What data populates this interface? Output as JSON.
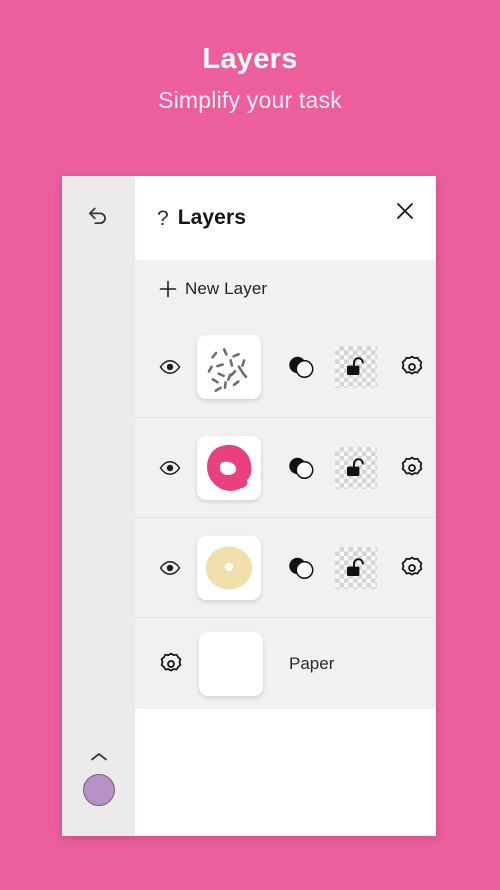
{
  "promo": {
    "title": "Layers",
    "subtitle": "Simplify your task"
  },
  "colors": {
    "background_pink": "#ec5f9c",
    "panel_white": "#ffffff",
    "row_grey": "#f1f1f1",
    "toolbar_grey": "#eceaea",
    "swatch_purple": "#b891c8",
    "frosting_pink": "#e8417e",
    "dough_cream": "#f0e0ab"
  },
  "toolbar": {
    "undo_icon": "undo-arrow-icon",
    "chevron_icon": "chevron-up-icon",
    "swatch_icon": "color-swatch",
    "swatch_color": "#b891c8"
  },
  "panel": {
    "help_icon": "?",
    "title": "Layers",
    "close_icon": "close-x-icon",
    "new_layer": {
      "plus_icon": "+",
      "label": "New Layer"
    },
    "layers": [
      {
        "name": "sprinkles-layer",
        "visible_icon": "eye-icon",
        "thumbnail": "sprinkles-thumbnail",
        "blend_icon": "blend-mode-icon",
        "lock_icon": "unlocked-padlock-icon",
        "settings_icon": "gear-icon"
      },
      {
        "name": "frosting-layer",
        "visible_icon": "eye-icon",
        "thumbnail": "pink-donut-thumbnail",
        "blend_icon": "blend-mode-icon",
        "lock_icon": "unlocked-padlock-icon",
        "settings_icon": "gear-icon"
      },
      {
        "name": "dough-layer",
        "visible_icon": "eye-icon",
        "thumbnail": "cream-donut-thumbnail",
        "blend_icon": "blend-mode-icon",
        "lock_icon": "unlocked-padlock-icon",
        "settings_icon": "gear-icon"
      }
    ],
    "paper_row": {
      "settings_icon": "gear-icon",
      "thumbnail": "blank-paper-thumbnail",
      "label": "Paper"
    }
  }
}
